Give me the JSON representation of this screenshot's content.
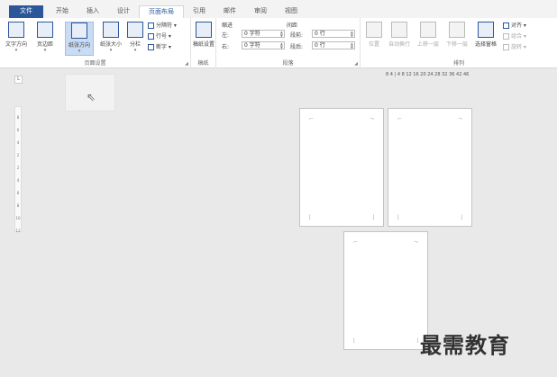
{
  "tabs": [
    {
      "label": "文件"
    },
    {
      "label": "开始"
    },
    {
      "label": "插入"
    },
    {
      "label": "设计"
    },
    {
      "label": "页面布局"
    },
    {
      "label": "引用"
    },
    {
      "label": "邮件"
    },
    {
      "label": "审阅"
    },
    {
      "label": "视图"
    }
  ],
  "ribbon": {
    "page_setup": {
      "label": "页面设置",
      "text_direction": "文字方向",
      "margins": "页边距",
      "orientation": "纸张方向",
      "size": "纸张大小",
      "columns": "分栏",
      "breaks": "分隔符",
      "line_numbers": "行号",
      "hyphenation": "断字"
    },
    "draft": {
      "label": "稿纸",
      "button": "稿纸设置"
    },
    "paragraph": {
      "label": "段落",
      "indent_label": "缩进",
      "spacing_label": "间距",
      "indent_left_label": "左:",
      "indent_left_value": "0 字符",
      "indent_right_label": "右:",
      "indent_right_value": "0 字符",
      "spacing_before_label": "段前:",
      "spacing_before_value": "0 行",
      "spacing_after_label": "段后:",
      "spacing_after_value": "0 行"
    },
    "arrange": {
      "label": "排列",
      "position": "位置",
      "wrap_text": "自动换行",
      "bring_forward": "上移一层",
      "send_backward": "下移一层",
      "selection_pane": "选择窗格",
      "align": "对齐",
      "group": "组合",
      "rotate": "旋转"
    }
  },
  "ruler": {
    "horizontal_ticks": "8 4 | 4  8  12 16 20 24 28 32 36  42 46",
    "corner": "L",
    "vertical_ticks": [
      "8",
      "6",
      "4",
      "2",
      "2",
      "4",
      "6",
      "8",
      "10",
      "12"
    ]
  },
  "watermark": "最需教育"
}
